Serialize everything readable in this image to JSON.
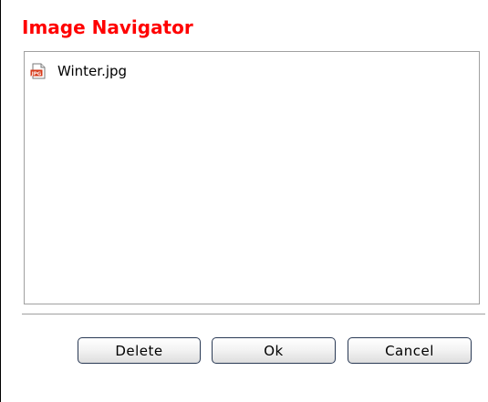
{
  "dialog": {
    "title": "Image Navigator",
    "title_color": "#ff0000"
  },
  "file_list": {
    "items": [
      {
        "name": "Winter.jpg",
        "icon": "jpg-file-icon",
        "icon_text": "JPG"
      }
    ]
  },
  "buttons": {
    "delete_label": "Delete",
    "ok_label": "Ok",
    "cancel_label": "Cancel"
  }
}
